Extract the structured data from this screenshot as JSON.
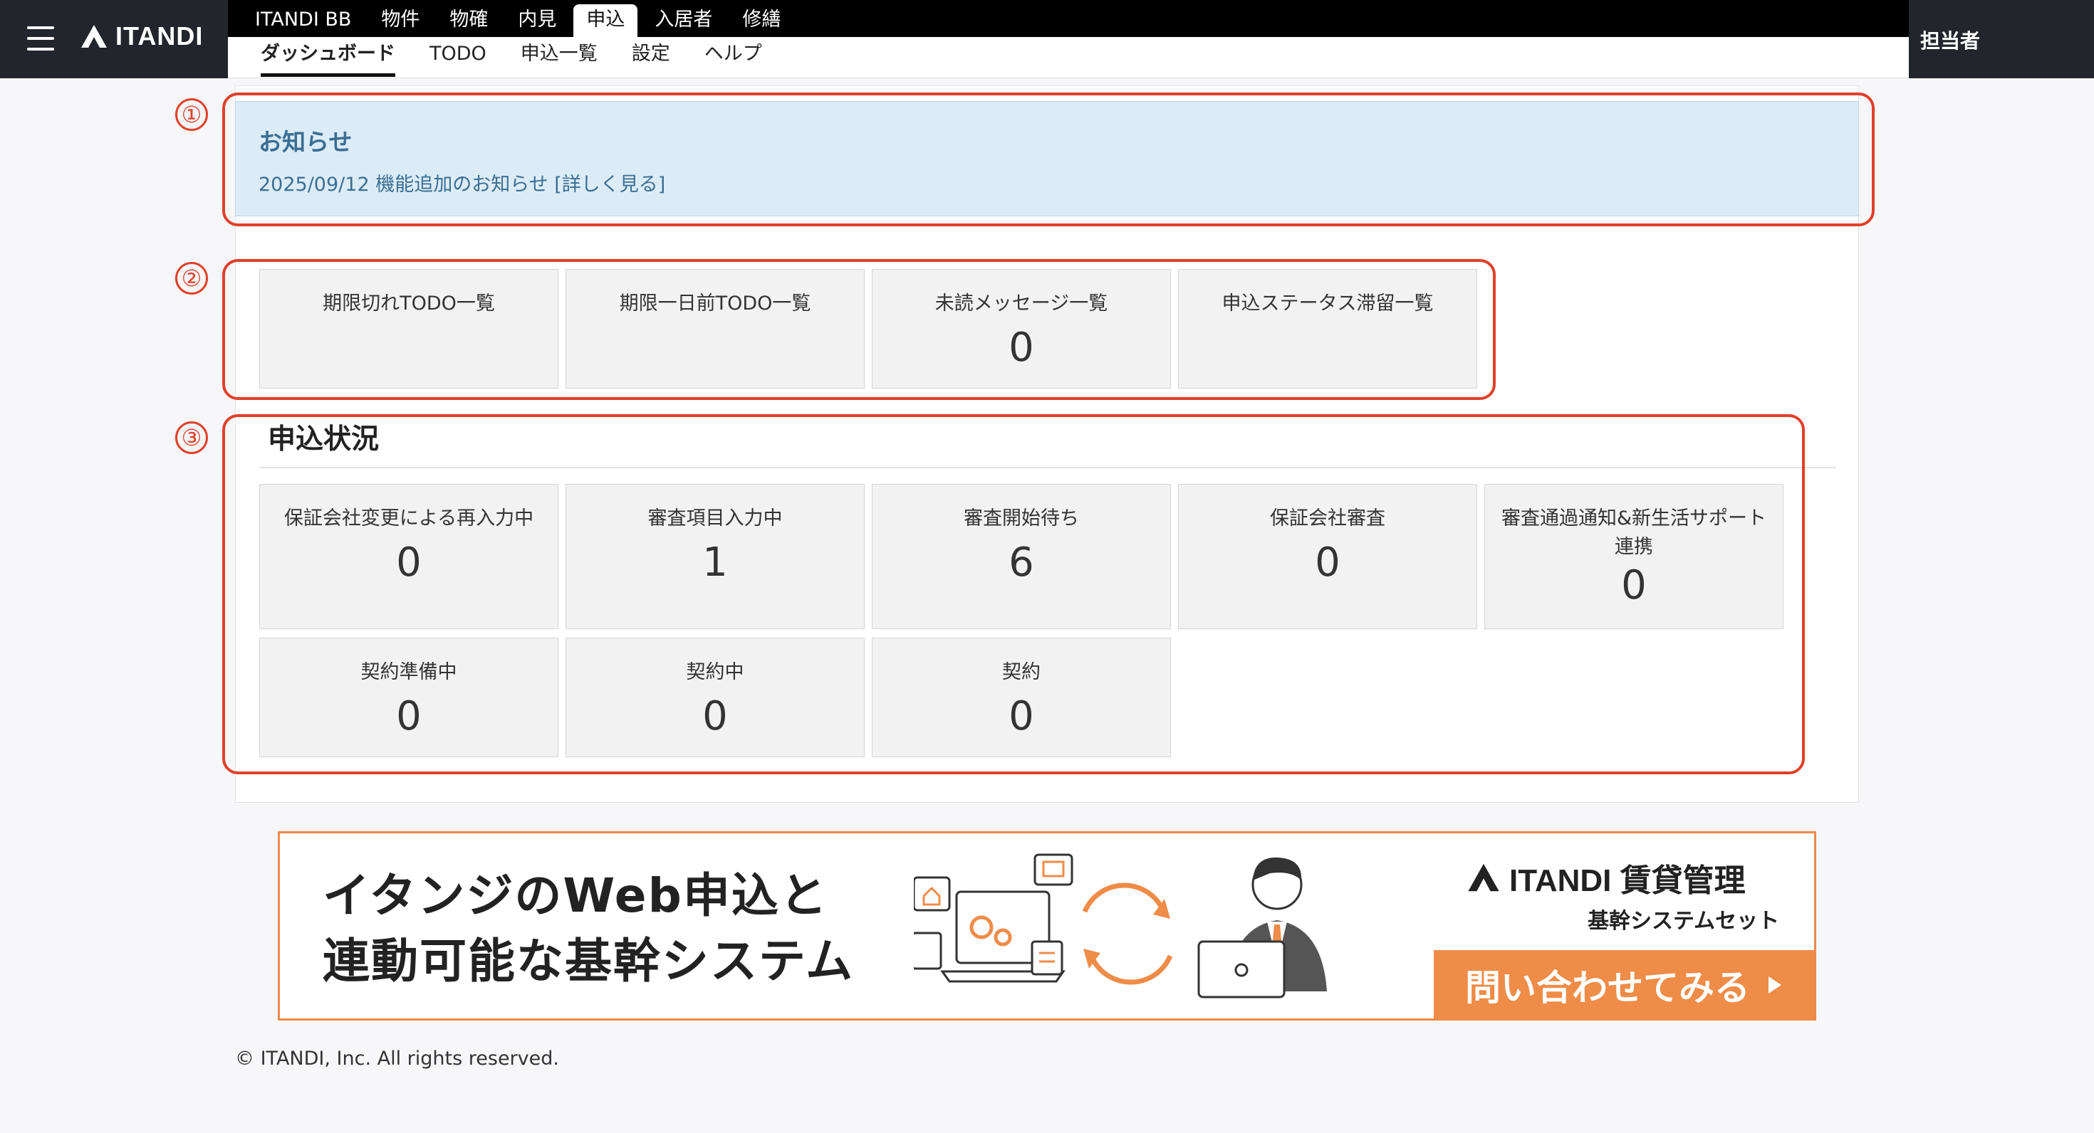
{
  "header": {
    "brand": "ITANDI",
    "top_tabs": [
      {
        "label": "ITANDI BB"
      },
      {
        "label": "物件"
      },
      {
        "label": "物確"
      },
      {
        "label": "内見"
      },
      {
        "label": "申込"
      },
      {
        "label": "入居者"
      },
      {
        "label": "修繕"
      }
    ],
    "active_top_tab": "申込",
    "sub_tabs": [
      {
        "label": "ダッシュボード"
      },
      {
        "label": "TODO"
      },
      {
        "label": "申込一覧"
      },
      {
        "label": "設定"
      },
      {
        "label": "ヘルプ"
      }
    ],
    "active_sub_tab": "ダッシュボード",
    "user_label": "担当者"
  },
  "notice": {
    "title": "お知らせ",
    "item_text": "2025/09/12 機能追加のお知らせ ",
    "item_link": "[詳しく見る]"
  },
  "annotations": [
    "①",
    "②",
    "③"
  ],
  "todo_cards": [
    {
      "label": "期限切れTODO一覧",
      "value": ""
    },
    {
      "label": "期限一日前TODO一覧",
      "value": ""
    },
    {
      "label": "未読メッセージ一覧",
      "value": "0"
    },
    {
      "label": "申込ステータス滞留一覧",
      "value": ""
    }
  ],
  "status_section": {
    "title": "申込状況",
    "cards": [
      {
        "label": "保証会社変更による再入力中",
        "value": "0"
      },
      {
        "label": "審査項目入力中",
        "value": "1"
      },
      {
        "label": "審査開始待ち",
        "value": "6"
      },
      {
        "label": "保証会社審査",
        "value": "0"
      },
      {
        "label": "審査通過通知&新生活サポート連携",
        "value": "0"
      },
      {
        "label": "契約準備中",
        "value": "0"
      },
      {
        "label": "契約中",
        "value": "0"
      },
      {
        "label": "契約",
        "value": "0"
      }
    ]
  },
  "banner": {
    "headline_line1": "イタンジのWeb申込と",
    "headline_line2": "連動可能な基幹システム",
    "brand": "ITANDI 賃貸管理",
    "subtitle": "基幹システムセット",
    "cta": "問い合わせてみる"
  },
  "footer": {
    "copyright": "© ITANDI, Inc. All rights reserved."
  },
  "colors": {
    "header_dark": "#23252d",
    "annotation_red": "#e0402a",
    "notice_bg": "#dcecf7",
    "notice_text": "#3b6e93",
    "cta_orange": "#ee8c48"
  }
}
